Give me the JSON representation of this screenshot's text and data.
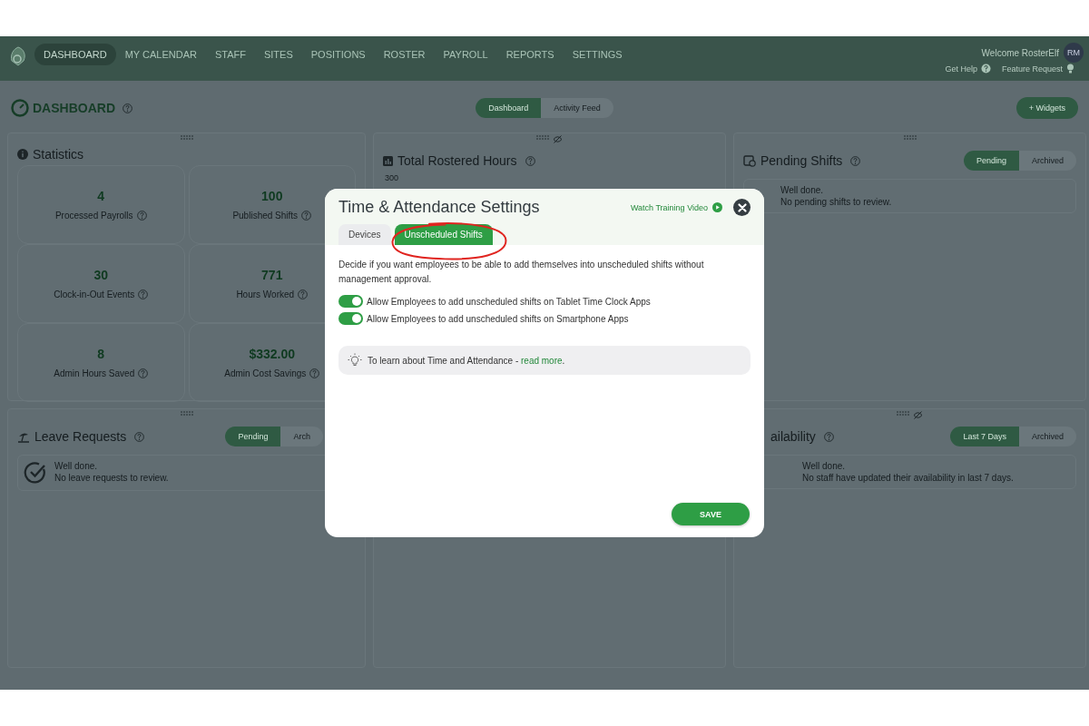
{
  "nav": {
    "items": [
      {
        "label": "DASHBOARD",
        "selected": true
      },
      {
        "label": "MY CALENDAR",
        "selected": false
      },
      {
        "label": "STAFF",
        "selected": false
      },
      {
        "label": "SITES",
        "selected": false
      },
      {
        "label": "POSITIONS",
        "selected": false
      },
      {
        "label": "ROSTER",
        "selected": false
      },
      {
        "label": "PAYROLL",
        "selected": false
      },
      {
        "label": "REPORTS",
        "selected": false
      },
      {
        "label": "SETTINGS",
        "selected": false
      }
    ],
    "welcome": "Welcome RosterElf",
    "avatar": "RM",
    "help": "Get Help",
    "feature_request": "Feature Request"
  },
  "header": {
    "title": "DASHBOARD",
    "views": [
      {
        "label": "Dashboard",
        "selected": true
      },
      {
        "label": "Activity Feed",
        "selected": false
      }
    ],
    "add_button": "+ Widgets"
  },
  "cards": [
    {
      "kind": "stats",
      "title": "Statistics",
      "stats": [
        {
          "value": "4",
          "label": "Processed Payrolls"
        },
        {
          "value": "100",
          "label": "Published Shifts"
        },
        {
          "value": "30",
          "label": "Clock-in-Out Events"
        },
        {
          "value": "771",
          "label": "Hours Worked"
        },
        {
          "value": "8",
          "label": "Admin Hours Saved"
        },
        {
          "value": "$332.00",
          "label": "Admin Cost Savings"
        }
      ]
    },
    {
      "kind": "chart",
      "title": "Total Rostered Hours",
      "hidden": true,
      "y_tick": "300"
    },
    {
      "kind": "list",
      "title": "Pending Shifts",
      "hidden": false,
      "check": false,
      "segments": [
        {
          "label": "Pending",
          "selected": true
        },
        {
          "label": "Archived",
          "selected": false
        }
      ],
      "lines": [
        "Well done.",
        "No pending shifts to review."
      ]
    },
    {
      "kind": "list",
      "title": "Leave Requests",
      "hidden": false,
      "check": true,
      "segments": [
        {
          "label": "Pending",
          "selected": true
        },
        {
          "label": "Arch",
          "selected": false
        }
      ],
      "lines": [
        "Well done.",
        "No leave requests to review."
      ]
    },
    {
      "kind": "panel"
    },
    {
      "kind": "list",
      "title": "ailability",
      "hidden": true,
      "check": false,
      "segments": [
        {
          "label": "Last 7 Days",
          "selected": true
        },
        {
          "label": "Archived",
          "selected": false
        }
      ],
      "lines": [
        "Well done.",
        "No staff have updated their availability in last 7 days."
      ]
    }
  ],
  "modal": {
    "title": "Time & Attendance Settings",
    "video_link": "Watch Training Video",
    "tabs": [
      {
        "label": "Devices",
        "selected": false
      },
      {
        "label": "Unscheduled Shifts",
        "selected": true
      }
    ],
    "description": "Decide if you want employees to be able to add themselves into unscheduled shifts without management approval.",
    "toggles": [
      {
        "label": "Allow Employees to add unscheduled shifts on Tablet Time Clock Apps",
        "on": true
      },
      {
        "label": "Allow Employees to add unscheduled shifts on Smartphone Apps",
        "on": true
      }
    ],
    "tip": "To learn about Time and Attendance - ",
    "tip_link": "read more",
    "tip_end": ".",
    "save": "SAVE"
  }
}
